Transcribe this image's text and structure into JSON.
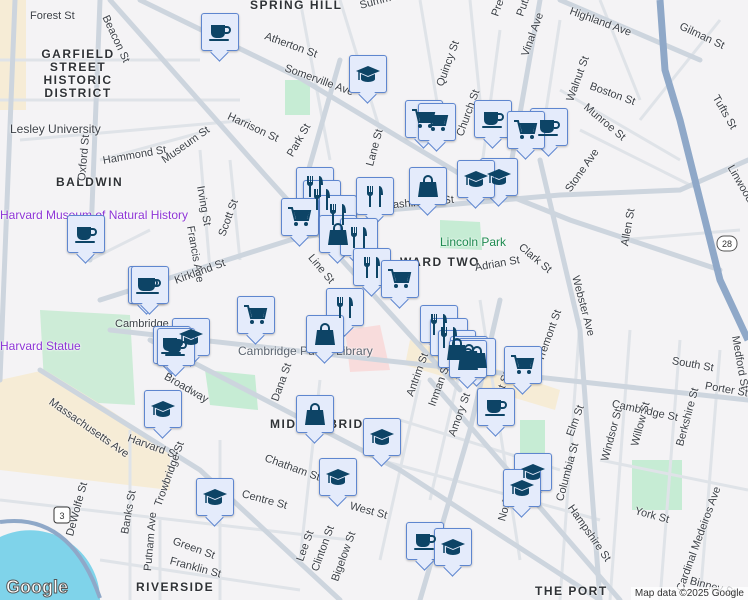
{
  "map": {
    "neighborhoods": [
      "Spring Hill",
      "Garfield Street Historic District",
      "Baldwin",
      "Ward Two",
      "Midcambridge",
      "Riverside",
      "The Port"
    ],
    "streets": [
      "Forest St",
      "Beacon St",
      "Somerville Ave",
      "Summer St",
      "Atherton St",
      "Highland Ave",
      "Gilman St",
      "Prescott St",
      "Putnam St",
      "Vinal Ave",
      "Walnut St",
      "Boston St",
      "Munroe St",
      "Tufts St",
      "Quincy St",
      "Church St",
      "Harrison St",
      "Park St",
      "Oxford St",
      "Hammond St",
      "Museum St",
      "Irving St",
      "Francis Ave",
      "Scott St",
      "Kirkland St",
      "Line St",
      "Lane St",
      "Washington St",
      "Stone Ave",
      "Clark St",
      "Adrian St",
      "Allen St",
      "Webster Ave",
      "Cambridge St",
      "Broadway",
      "Massachusetts Ave",
      "Harvard St",
      "Trowbridge St",
      "Dana St",
      "Chatham St",
      "Centre St",
      "West St",
      "DeWolfe St",
      "Banks St",
      "Putnam Ave",
      "Green St",
      "Franklin St",
      "Lee St",
      "Clinton St",
      "Bigelow St",
      "Antrim St",
      "Inman St",
      "Amory St",
      "Prospect St",
      "Tremont St",
      "Elm St",
      "Columbia St",
      "Hampshire St",
      "Windsor St",
      "Willow St",
      "Berkshire St",
      "York St",
      "South St",
      "Porter St",
      "Cardinal Medeiros Ave",
      "Norfolk St",
      "Binney St",
      "Linwood St",
      "Medford St",
      "Kirkland St"
    ],
    "pois": [
      "Lesley University",
      "Harvard Museum of Natural History",
      "Cambridge Public Library",
      "Harvard Statue",
      "Lincoln Park",
      "Cambridge"
    ],
    "route_shields": [
      "28",
      "3"
    ],
    "attribution": "Map data ©2025 Google",
    "logo": "Google"
  },
  "markers": {
    "coffee": "coffee-cup-icon",
    "education": "graduation-cap-icon",
    "restaurant": "fork-knife-icon",
    "grocery": "shopping-cart-icon",
    "shopping": "shopping-bag-icon"
  },
  "colors": {
    "marker_bg": "#e4ebfb",
    "marker_border": "#5e86cf",
    "marker_icon": "#0d4466",
    "highway": "#8fa8c8",
    "water": "#7fd3ea",
    "park": "#c6ecd4"
  }
}
